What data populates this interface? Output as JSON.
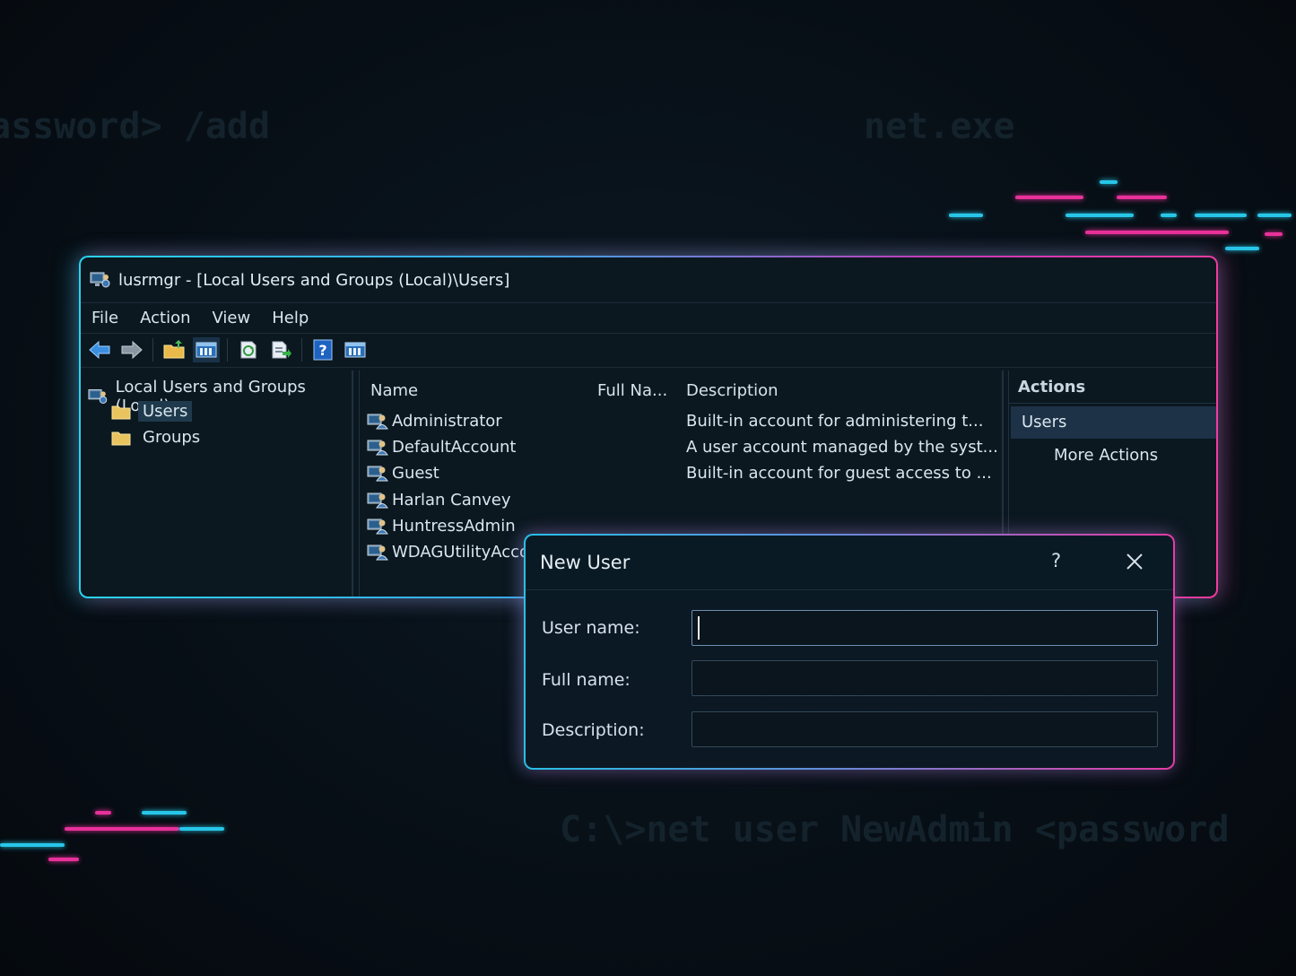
{
  "background": {
    "code_left": "assword> /add",
    "code_right": "net.exe",
    "code_bottom": "C:\\>net user NewAdmin <password"
  },
  "colors": {
    "accent_cyan": "#29d3f2",
    "accent_magenta": "#f03b9f"
  },
  "window": {
    "title": "lusrmgr - [Local Users and Groups (Local)\\Users]",
    "menu": [
      "File",
      "Action",
      "View",
      "Help"
    ],
    "toolbar_icons": [
      "back-arrow-icon",
      "forward-arrow-icon",
      "up-folder-icon",
      "show-hide-tree-icon",
      "refresh-icon",
      "export-list-icon",
      "help-icon",
      "properties-icon"
    ]
  },
  "tree": {
    "root": "Local Users and Groups (Local)",
    "items": [
      "Users",
      "Groups"
    ],
    "selected": "Users"
  },
  "list": {
    "columns": [
      "Name",
      "Full Na...",
      "Description"
    ],
    "rows": [
      {
        "name": "Administrator",
        "full_name": "",
        "description": "Built-in account for administering t..."
      },
      {
        "name": "DefaultAccount",
        "full_name": "",
        "description": "A user account managed by the syst..."
      },
      {
        "name": "Guest",
        "full_name": "",
        "description": "Built-in account for guest access to ..."
      },
      {
        "name": "Harlan Canvey",
        "full_name": "",
        "description": ""
      },
      {
        "name": "HuntressAdmin",
        "full_name": "",
        "description": ""
      },
      {
        "name": "WDAGUtilityAccou...",
        "full_name": "",
        "description": ""
      }
    ]
  },
  "actions": {
    "header": "Actions",
    "section": "Users",
    "more": "More Actions"
  },
  "dialog": {
    "title": "New User",
    "help": "?",
    "fields": [
      {
        "label": "User name:",
        "value": ""
      },
      {
        "label": "Full name:",
        "value": ""
      },
      {
        "label": "Description:",
        "value": ""
      }
    ]
  }
}
